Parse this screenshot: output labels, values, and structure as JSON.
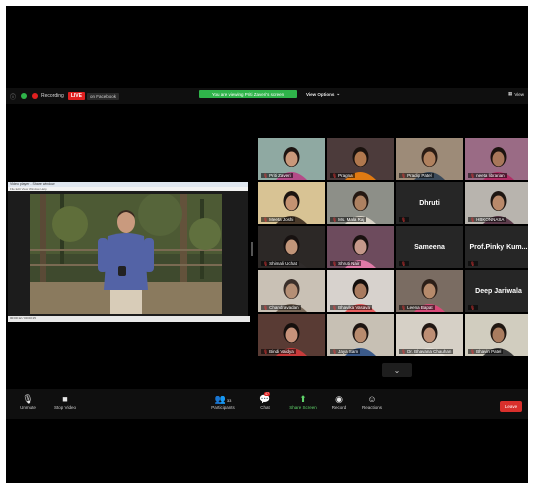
{
  "topbar": {
    "recording_label": "Recording",
    "live_badge": "LIVE",
    "facebook_label": "on Facebook",
    "viewing_banner": "You are viewing Priti Zaveri's screen",
    "view_options": "View Options",
    "view_button": "View"
  },
  "participants": [
    {
      "name": "Priti Zaveri",
      "bg": "#8fa9a2",
      "skin": "#c9987a",
      "hair": "#1d1411",
      "shirt": "#b44b88",
      "active": true
    },
    {
      "name": "Pragna",
      "bg": "#4c3b3b",
      "skin": "#b0784e",
      "hair": "#1a120e",
      "shirt": "#e07a12"
    },
    {
      "name": "Pradip Patel",
      "bg": "#9d8b78",
      "skin": "#b0815e",
      "hair": "#2a1c14",
      "shirt": "#3b4a5a"
    },
    {
      "name": "neeta librarian",
      "bg": "#9a6b85",
      "skin": "#a8775a",
      "hair": "#1b120e",
      "shirt": "#b02e66"
    },
    {
      "name": "Meeta Joshi",
      "bg": "#d8c394",
      "skin": "#c49271",
      "hair": "#1b1410",
      "shirt": "#4a3a2a"
    },
    {
      "name": "Ms. Mala Raj",
      "bg": "#8d8f88",
      "skin": "#ad8161",
      "hair": "#241812",
      "shirt": "#d9d4c8"
    },
    {
      "name": "Dhruti",
      "initials": "Dhruti"
    },
    {
      "name": "HBKONNASA",
      "bg": "#b8b4ae",
      "skin": "#b9896a",
      "hair": "#1e1612",
      "shirt": "#5c3b4b"
    },
    {
      "name": "Shimali Uchat",
      "bg": "#2c2826",
      "skin": "#c19579",
      "hair": "#171110",
      "shirt": "#2f2b2a"
    },
    {
      "name": "Shruti Nair",
      "bg": "#6d4b5d",
      "skin": "#c5988a",
      "hair": "#1a1110",
      "shirt": "#e07aa8"
    },
    {
      "name": "Sameena",
      "initials": "Sameena"
    },
    {
      "name": "Prof.Pinky Kumari",
      "initials": "Prof.Pinky  Kum..."
    },
    {
      "name": "Chandravadan",
      "bg": "#c9c1b5",
      "skin": "#b58f75",
      "hair": "#3a2f2a",
      "shirt": "#7a6a5a"
    },
    {
      "name": "Bhavika Vasava",
      "bg": "#d7d2cd",
      "skin": "#a97b5f",
      "hair": "#120d0b",
      "shirt": "#e95f5f"
    },
    {
      "name": "Leena Bapat",
      "bg": "#7a6c62",
      "skin": "#b68a6b",
      "hair": "#2b1e17",
      "shirt": "#d84a78"
    },
    {
      "name": "Deep Jariwala",
      "initials": "Deep Jariwala"
    },
    {
      "name": "Bindi Vaidya",
      "bg": "#593b34",
      "skin": "#c6927a",
      "hair": "#150f0d",
      "shirt": "#c73b3b"
    },
    {
      "name": "Jaya Sam",
      "bg": "#c7c0b4",
      "skin": "#b88b6e",
      "hair": "#1c1411",
      "shirt": "#3b5a8a"
    },
    {
      "name": "Dr. Bhavana Chauhan",
      "bg": "#d6d0c6",
      "skin": "#bd8e74",
      "hair": "#201612",
      "shirt": "#e6e2da"
    },
    {
      "name": "Bhavin Patel",
      "bg": "#d1cdbf",
      "skin": "#a97c5f",
      "hair": "#201712",
      "shirt": "#3a3a3a"
    }
  ],
  "shared_window": {
    "title": "Video player - Share window",
    "menu": "File  Edit  View  Window  Help",
    "status": "00:00:12 / 00:03:15"
  },
  "controls": {
    "unmute": "Unmute",
    "stop_video": "Stop Video",
    "participants": "Participants",
    "participants_count": "33",
    "chat": "Chat",
    "chat_badge": "47",
    "share_screen": "Share Screen",
    "record": "Record",
    "reactions": "Reactions",
    "leave": "Leave"
  }
}
